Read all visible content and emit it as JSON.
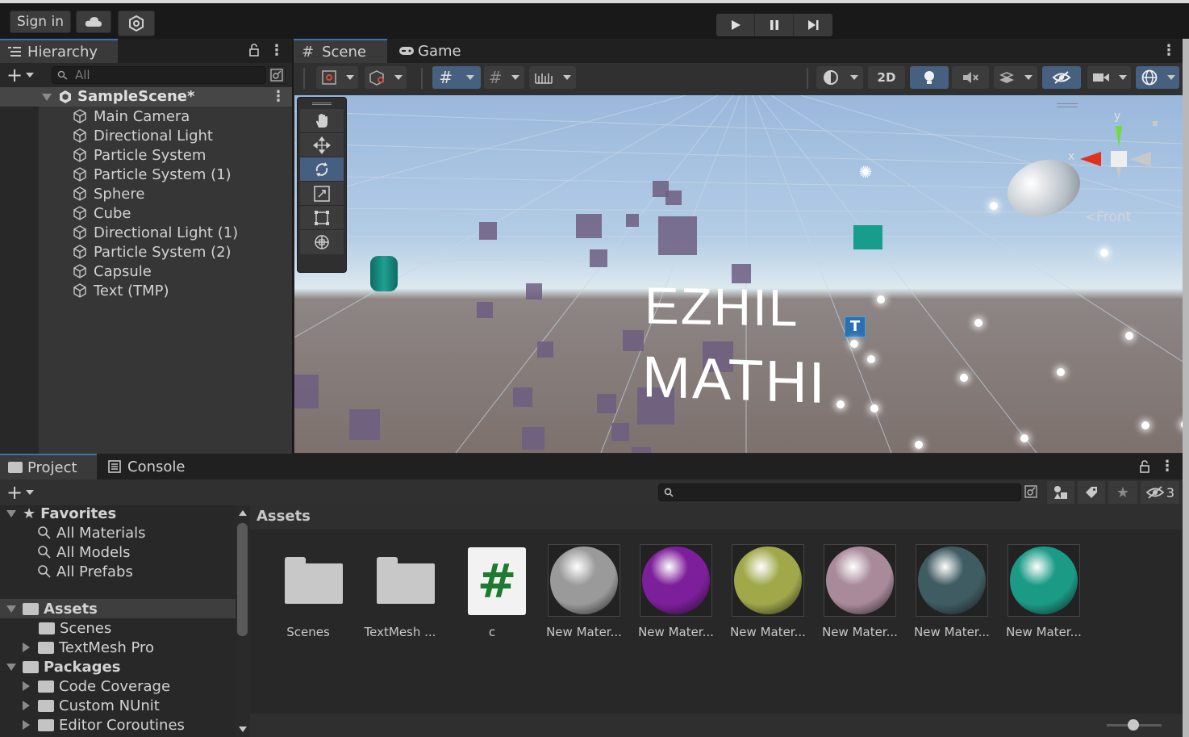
{
  "toolbar": {
    "sign_in": "Sign in",
    "cloud_icon": "cloud-icon",
    "collab_icon": "collab-icon",
    "play_icons": [
      "play-icon",
      "pause-icon",
      "step-icon"
    ]
  },
  "hierarchy": {
    "tab": "Hierarchy",
    "search_placeholder": "All",
    "scene_name": "SampleScene*",
    "items": [
      {
        "label": "Main Camera"
      },
      {
        "label": "Directional Light"
      },
      {
        "label": "Particle System"
      },
      {
        "label": "Particle System (1)"
      },
      {
        "label": "Sphere"
      },
      {
        "label": "Cube"
      },
      {
        "label": "Directional Light (1)"
      },
      {
        "label": "Particle System (2)"
      },
      {
        "label": "Capsule"
      },
      {
        "label": "Text (TMP)"
      }
    ]
  },
  "scene_view": {
    "tabs": [
      {
        "label": "Scene"
      },
      {
        "label": "Game"
      }
    ],
    "mode_2d": "2D",
    "scene_text_1": "EZHIL",
    "scene_text_2": "MATHI",
    "gizmo_y": "y",
    "gizmo_x": "x",
    "gizmo_label": "Front",
    "tools": [
      "hand-icon",
      "move-icon",
      "rotate-icon",
      "scale-icon",
      "rect-icon",
      "transform-icon"
    ]
  },
  "project": {
    "tabs": [
      {
        "label": "Project"
      },
      {
        "label": "Console"
      }
    ],
    "hidden_count": "3",
    "favorites": {
      "label": "Favorites",
      "items": [
        {
          "label": "All Materials"
        },
        {
          "label": "All Models"
        },
        {
          "label": "All Prefabs"
        }
      ]
    },
    "assets_label": "Assets",
    "assets_children": [
      {
        "label": "Scenes"
      },
      {
        "label": "TextMesh Pro"
      }
    ],
    "packages_label": "Packages",
    "packages_children": [
      {
        "label": "Code Coverage"
      },
      {
        "label": "Custom NUnit"
      },
      {
        "label": "Editor Coroutines"
      }
    ],
    "breadcrumb": "Assets",
    "assets": [
      {
        "label": "Scenes",
        "kind": "folder"
      },
      {
        "label": "TextMesh ...",
        "kind": "folder"
      },
      {
        "label": "c",
        "kind": "script",
        "glyph": "#"
      },
      {
        "label": "New Mater...",
        "kind": "material",
        "color": "#9a9a9a"
      },
      {
        "label": "New Mater...",
        "kind": "material",
        "color": "#7d1e9a"
      },
      {
        "label": "New Mater...",
        "kind": "material",
        "color": "#a0a84a"
      },
      {
        "label": "New Mater...",
        "kind": "material",
        "color": "#a98a9b"
      },
      {
        "label": "New Mater...",
        "kind": "material",
        "color": "#3f5c62"
      },
      {
        "label": "New Mater...",
        "kind": "material",
        "color": "#1b9b86"
      }
    ]
  }
}
